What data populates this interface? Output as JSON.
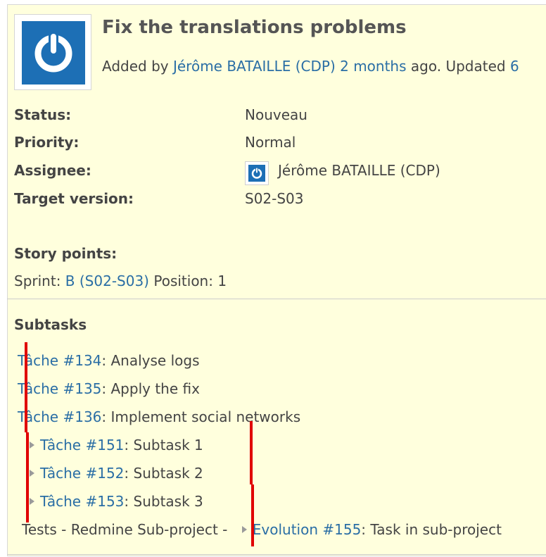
{
  "issue": {
    "title": "Fix the translations problems",
    "added_prefix": "Added by",
    "author": "Jérôme BATAILLE (CDP)",
    "created_ago": "2 months",
    "updated_text": "ago. Updated",
    "updated_ago_partial": "6"
  },
  "attributes": {
    "status_label": "Status:",
    "status_value": "Nouveau",
    "priority_label": "Priority:",
    "priority_value": "Normal",
    "assignee_label": "Assignee:",
    "assignee_value": "Jérôme BATAILLE (CDP)",
    "target_label": "Target version:",
    "target_value": "S02-S03"
  },
  "story": {
    "label": "Story points:",
    "sprint_prefix": "Sprint:",
    "sprint_link": "B (S02-S03)",
    "position_text": "Position: 1"
  },
  "subtasks": {
    "heading": "Subtasks",
    "items": [
      {
        "link": "Tâche #134",
        "text": ": Analyse logs"
      },
      {
        "link": "Tâche #135",
        "text": ": Apply the fix"
      },
      {
        "link": "Tâche #136",
        "text": ": Implement social networks"
      },
      {
        "link": "Tâche #151",
        "text": ": Subtask 1"
      },
      {
        "link": "Tâche #152",
        "text": ": Subtask 2"
      },
      {
        "link": "Tâche #153",
        "text": ": Subtask 3"
      }
    ],
    "subproject_prefix": "Tests - Redmine Sub-project -",
    "subproject_link": "Evolution #155",
    "subproject_text": ": Task in sub-project"
  },
  "colors": {
    "panel_bg": "#ffffdd",
    "link": "#2a6ea5",
    "avatar_blue": "#1d6fb5",
    "annotation_red": "#e00000"
  }
}
